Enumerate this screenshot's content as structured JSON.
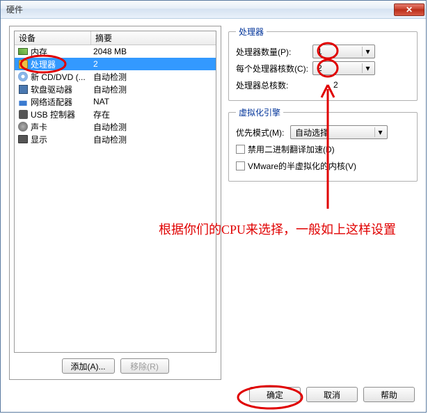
{
  "window": {
    "title": "硬件"
  },
  "device_list": {
    "header_device": "设备",
    "header_summary": "摘要",
    "rows": [
      {
        "icon": "mem",
        "name": "内存",
        "summary": "2048 MB",
        "selected": false
      },
      {
        "icon": "cpu",
        "name": "处理器",
        "summary": "2",
        "selected": true
      },
      {
        "icon": "cd",
        "name": "新 CD/DVD (...",
        "summary": "自动检测",
        "selected": false
      },
      {
        "icon": "fd",
        "name": "软盘驱动器",
        "summary": "自动检测",
        "selected": false
      },
      {
        "icon": "net",
        "name": "网络适配器",
        "summary": "NAT",
        "selected": false
      },
      {
        "icon": "usb",
        "name": "USB 控制器",
        "summary": "存在",
        "selected": false
      },
      {
        "icon": "snd",
        "name": "声卡",
        "summary": "自动检测",
        "selected": false
      },
      {
        "icon": "disp",
        "name": "显示",
        "summary": "自动检测",
        "selected": false
      }
    ]
  },
  "left_buttons": {
    "add": "添加(A)...",
    "remove": "移除(R)"
  },
  "processor_group": {
    "legend": "处理器",
    "count_label": "处理器数量(P):",
    "count_value": "1",
    "cores_label": "每个处理器核数(C):",
    "cores_value": "2",
    "total_label": "处理器总核数:",
    "total_value": "2"
  },
  "virtualization_group": {
    "legend": "虚拟化引擎",
    "mode_label": "优先模式(M):",
    "mode_value": "自动选择",
    "cb1": "禁用二进制翻译加速(D)",
    "cb2": "VMware的半虚拟化的内核(V)"
  },
  "bottom": {
    "ok": "确定",
    "cancel": "取消",
    "help": "帮助"
  },
  "annotation": {
    "text": "根据你们的CPU来选择，一般如上这样设置"
  }
}
